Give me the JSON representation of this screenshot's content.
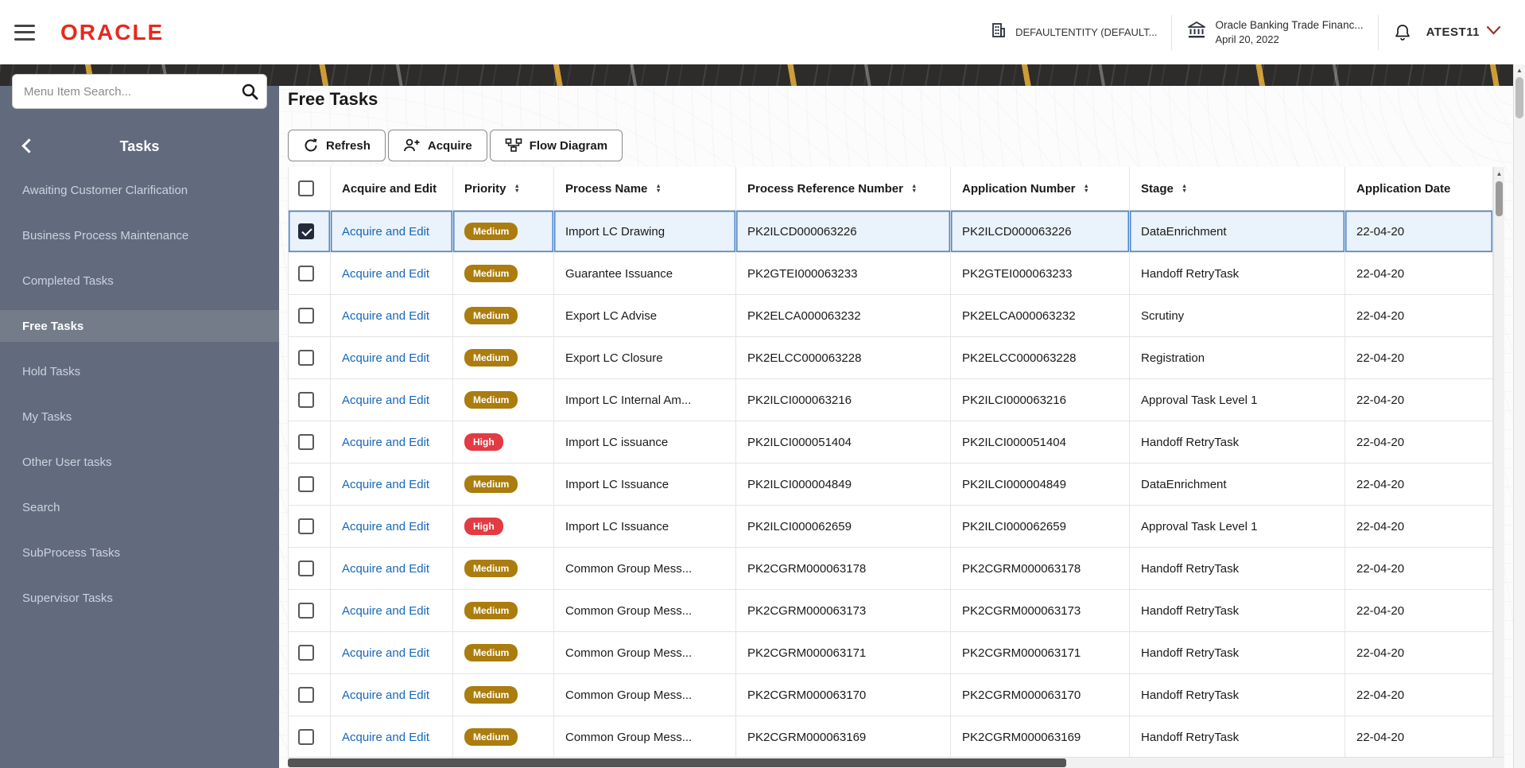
{
  "header": {
    "logo_text": "ORACLE",
    "entity_label": "DEFAULTENTITY (DEFAULT...",
    "app_name": "Oracle Banking Trade Financ...",
    "app_date": "April 20, 2022",
    "username": "ATEST11"
  },
  "sidebar": {
    "search_placeholder": "Menu Item Search...",
    "title": "Tasks",
    "items": [
      {
        "label": "Awaiting Customer Clarification",
        "active": false
      },
      {
        "label": "Business Process Maintenance",
        "active": false
      },
      {
        "label": "Completed Tasks",
        "active": false
      },
      {
        "label": "Free Tasks",
        "active": true
      },
      {
        "label": "Hold Tasks",
        "active": false
      },
      {
        "label": "My Tasks",
        "active": false
      },
      {
        "label": "Other User tasks",
        "active": false
      },
      {
        "label": "Search",
        "active": false
      },
      {
        "label": "SubProcess Tasks",
        "active": false
      },
      {
        "label": "Supervisor Tasks",
        "active": false
      }
    ]
  },
  "main": {
    "title": "Free Tasks",
    "toolbar": [
      {
        "label": "Refresh",
        "icon": "refresh-icon"
      },
      {
        "label": "Acquire",
        "icon": "acquire-icon"
      },
      {
        "label": "Flow Diagram",
        "icon": "flow-diagram-icon"
      }
    ],
    "table": {
      "action_label": "Acquire and Edit",
      "columns": [
        {
          "label": "",
          "sortable": false
        },
        {
          "label": "Acquire and Edit",
          "sortable": false
        },
        {
          "label": "Priority",
          "sortable": true
        },
        {
          "label": "Process Name",
          "sortable": true
        },
        {
          "label": "Process Reference Number",
          "sortable": true
        },
        {
          "label": "Application Number",
          "sortable": true
        },
        {
          "label": "Stage",
          "sortable": true
        },
        {
          "label": "Application Date",
          "sortable": false
        }
      ],
      "rows": [
        {
          "checked": true,
          "priority": "Medium",
          "process_name": "Import LC Drawing",
          "process_ref": "PK2ILCD000063226",
          "application_number": "PK2ILCD000063226",
          "stage": "DataEnrichment",
          "application_date": "22-04-20"
        },
        {
          "checked": false,
          "priority": "Medium",
          "process_name": "Guarantee Issuance",
          "process_ref": "PK2GTEI000063233",
          "application_number": "PK2GTEI000063233",
          "stage": "Handoff RetryTask",
          "application_date": "22-04-20"
        },
        {
          "checked": false,
          "priority": "Medium",
          "process_name": "Export LC Advise",
          "process_ref": "PK2ELCA000063232",
          "application_number": "PK2ELCA000063232",
          "stage": "Scrutiny",
          "application_date": "22-04-20"
        },
        {
          "checked": false,
          "priority": "Medium",
          "process_name": "Export LC Closure",
          "process_ref": "PK2ELCC000063228",
          "application_number": "PK2ELCC000063228",
          "stage": "Registration",
          "application_date": "22-04-20"
        },
        {
          "checked": false,
          "priority": "Medium",
          "process_name": "Import LC Internal Am...",
          "process_ref": "PK2ILCI000063216",
          "application_number": "PK2ILCI000063216",
          "stage": "Approval Task Level 1",
          "application_date": "22-04-20"
        },
        {
          "checked": false,
          "priority": "High",
          "process_name": "Import LC issuance",
          "process_ref": "PK2ILCI000051404",
          "application_number": "PK2ILCI000051404",
          "stage": "Handoff RetryTask",
          "application_date": "22-04-20"
        },
        {
          "checked": false,
          "priority": "Medium",
          "process_name": "Import LC Issuance",
          "process_ref": "PK2ILCI000004849",
          "application_number": "PK2ILCI000004849",
          "stage": "DataEnrichment",
          "application_date": "22-04-20"
        },
        {
          "checked": false,
          "priority": "High",
          "process_name": "Import LC Issuance",
          "process_ref": "PK2ILCI000062659",
          "application_number": "PK2ILCI000062659",
          "stage": "Approval Task Level 1",
          "application_date": "22-04-20"
        },
        {
          "checked": false,
          "priority": "Medium",
          "process_name": "Common Group Mess...",
          "process_ref": "PK2CGRM000063178",
          "application_number": "PK2CGRM000063178",
          "stage": "Handoff RetryTask",
          "application_date": "22-04-20"
        },
        {
          "checked": false,
          "priority": "Medium",
          "process_name": "Common Group Mess...",
          "process_ref": "PK2CGRM000063173",
          "application_number": "PK2CGRM000063173",
          "stage": "Handoff RetryTask",
          "application_date": "22-04-20"
        },
        {
          "checked": false,
          "priority": "Medium",
          "process_name": "Common Group Mess...",
          "process_ref": "PK2CGRM000063171",
          "application_number": "PK2CGRM000063171",
          "stage": "Handoff RetryTask",
          "application_date": "22-04-20"
        },
        {
          "checked": false,
          "priority": "Medium",
          "process_name": "Common Group Mess...",
          "process_ref": "PK2CGRM000063170",
          "application_number": "PK2CGRM000063170",
          "stage": "Handoff RetryTask",
          "application_date": "22-04-20"
        },
        {
          "checked": false,
          "priority": "Medium",
          "process_name": "Common Group Mess...",
          "process_ref": "PK2CGRM000063169",
          "application_number": "PK2CGRM000063169",
          "stage": "Handoff RetryTask",
          "application_date": "22-04-20"
        }
      ]
    }
  },
  "colors": {
    "oracle_red": "#e8281e",
    "link_blue": "#1667b8",
    "priority_medium": "#ab7c0e",
    "priority_high": "#e23b43",
    "sidebar_bg": "#626a7e",
    "sidebar_active_bg": "#747c8a",
    "selected_row_bg": "#eaf2fb",
    "selected_row_border": "#4a86cf"
  }
}
